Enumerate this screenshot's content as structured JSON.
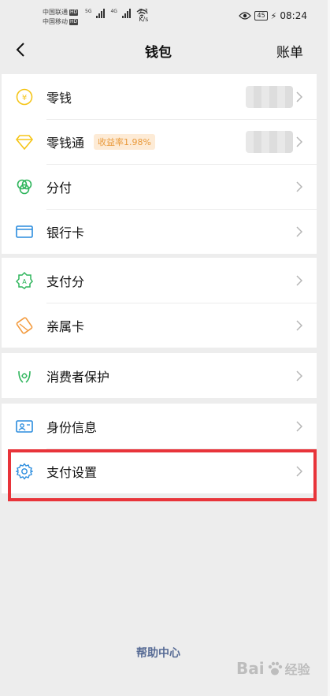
{
  "status_bar": {
    "carrier1": "中国联通",
    "carrier2": "中国移动",
    "hd": "HD",
    "sig1": "5G",
    "sig2": "4G",
    "speed_value": "7.1",
    "speed_unit": "K/s",
    "battery": "45",
    "time": "08:24"
  },
  "nav": {
    "title": "钱包",
    "right_link": "账单"
  },
  "group1": [
    {
      "label": "零钱",
      "icon": "yuan-coin-icon",
      "color": "#f5c518"
    },
    {
      "label": "零钱通",
      "icon": "diamond-icon",
      "color": "#f5c518",
      "badge": "收益率1.98%"
    },
    {
      "label": "分付",
      "icon": "fenfu-icon",
      "color": "#2fb55c"
    },
    {
      "label": "银行卡",
      "icon": "bank-card-icon",
      "color": "#2a8cde"
    }
  ],
  "group2": [
    {
      "label": "支付分",
      "icon": "payscore-icon",
      "color": "#2fb55c"
    },
    {
      "label": "亲属卡",
      "icon": "family-card-icon",
      "color": "#f39a3d"
    }
  ],
  "group3": [
    {
      "label": "消费者保护",
      "icon": "consumer-protect-icon",
      "color": "#2fb55c"
    }
  ],
  "group4": [
    {
      "label": "身份信息",
      "icon": "id-card-icon",
      "color": "#2a8cde"
    },
    {
      "label": "支付设置",
      "icon": "settings-gear-icon",
      "color": "#2a8cde"
    }
  ],
  "footer": {
    "help_center": "帮助中心",
    "watermark_text": "Bai",
    "watermark_sub": "经验"
  },
  "colors": {
    "background": "#ededed",
    "highlight_border": "#e8343a",
    "link": "#576b95"
  }
}
